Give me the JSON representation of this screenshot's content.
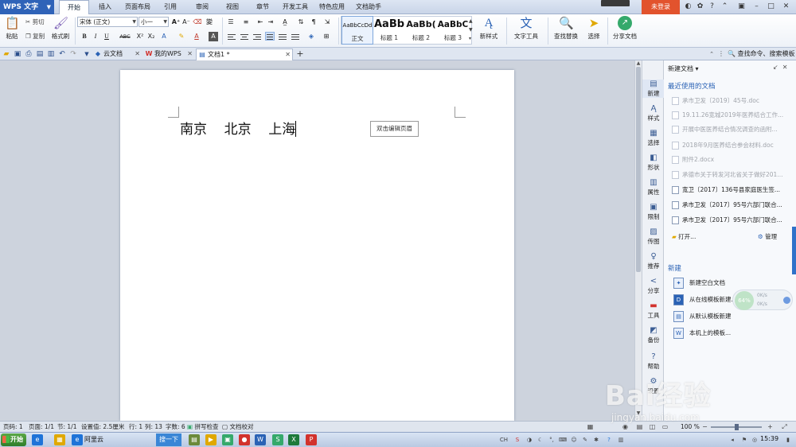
{
  "app": {
    "name": "WPS 文字",
    "login_label": "未登录"
  },
  "menu": {
    "tabs": [
      "开始",
      "插入",
      "页面布局",
      "引用",
      "审阅",
      "视图",
      "章节",
      "开发工具",
      "特色应用",
      "文档助手"
    ],
    "active_tab": "开始"
  },
  "ribbon": {
    "paste": "粘贴",
    "cut": "剪切",
    "copy": "复制",
    "format_painter": "格式刷",
    "font_name": "宋体 (正文)",
    "font_size": "小一",
    "bold": "B",
    "italic": "I",
    "underline": "U",
    "strike": "ABC",
    "superscript": "X²",
    "subscript": "X₂",
    "font_color_glyph": "A",
    "styles": [
      {
        "sample": "AaBbCcDd",
        "label": "正文"
      },
      {
        "sample": "AaBb",
        "label": "标题 1"
      },
      {
        "sample": "AaBb(",
        "label": "标题 2"
      },
      {
        "sample": "AaBbC",
        "label": "标题 3"
      }
    ],
    "new_style": "新样式",
    "text_tool": "文字工具",
    "find_replace": "查找替换",
    "select": "选择",
    "share_doc": "分享文档"
  },
  "tabs_bar": {
    "doc_tabs": [
      {
        "label": "云文档"
      },
      {
        "label": "我的WPS"
      },
      {
        "label": "文档1 *"
      }
    ],
    "search_label": "查找命令、搜索模板"
  },
  "document": {
    "text": "南京    北京    上海",
    "header_hint": "双击编辑页眉"
  },
  "rail": {
    "items": [
      "新建",
      "样式",
      "选择",
      "形状",
      "属性",
      "限制",
      "传图",
      "推荐",
      "分享",
      "工具",
      "备份",
      "帮助",
      "设置"
    ]
  },
  "taskpane": {
    "title": "新建文档",
    "recent_heading": "最近使用的文档",
    "recent": [
      {
        "name": "承市卫发〔2019〕45号.doc",
        "dim": true
      },
      {
        "name": "19.11.26宽城2019年医养结合工作...",
        "dim": true
      },
      {
        "name": "开展中医医养结合情况调查的函附...",
        "dim": true
      },
      {
        "name": "2018年9月医养结合参会材料.doc",
        "dim": true
      },
      {
        "name": "附件2.docx",
        "dim": true
      },
      {
        "name": "承德市关于转发河北省关于做好201...",
        "dim": true
      },
      {
        "name": "宽卫〔2017〕136号县家庭医生签...",
        "dim": false
      },
      {
        "name": "承市卫发〔2017〕95号六部门联合...",
        "dim": false
      },
      {
        "name": "承市卫发〔2017〕95号六部门联合...",
        "dim": false
      }
    ],
    "open_label": "打开...",
    "manage_label": "管理",
    "new_heading": "新建",
    "new_items": [
      "新建空白文档",
      "从在线模板新建...",
      "从默认模板新建",
      "本机上的模板..."
    ],
    "speed_up": "0K/s",
    "speed_down": "0K/s",
    "speed_pct": "64%"
  },
  "status": {
    "page": "页码: 1",
    "pages": "页面: 1/1",
    "section": "节: 1/1",
    "setting": "设置值: 2.5厘米",
    "row": "行: 1",
    "col": "列: 13",
    "words": "字数: 6",
    "spell": "拼写检查",
    "proof": "文档校对",
    "zoom": "100 %",
    "zoom_fraction": 0.5
  },
  "taskbar": {
    "start": "开始",
    "aliyun": "阿里云",
    "sogou": "搜一下",
    "clock": "15:39",
    "ime": "CH"
  },
  "watermark": {
    "logo": "Bai经验",
    "url": "jingyan.baidu.com"
  }
}
